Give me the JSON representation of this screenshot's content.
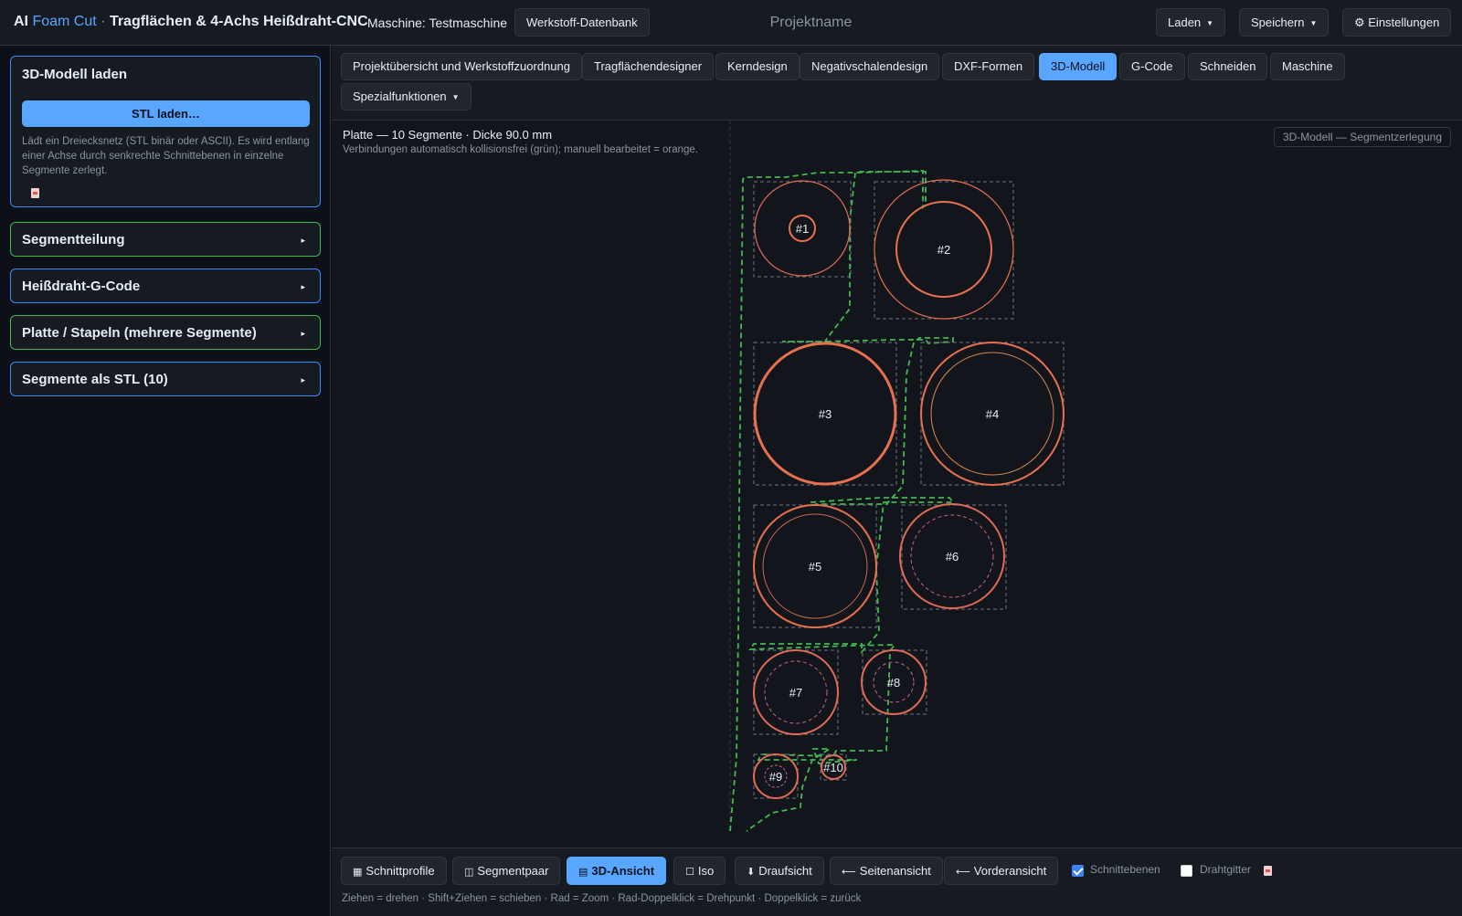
{
  "header": {
    "title_prefix": "AI",
    "title_accent": "Foam Cut",
    "title_sep": "·",
    "title_rest": "Tragflächen & 4-Achs Heißdraht-CNC",
    "machine": "Maschine: Testmaschine",
    "material_db_label": "Werkstoff-Datenbank",
    "project_placeholder": "Projektname",
    "load_label": "Laden",
    "save_label": "Speichern",
    "settings_label": "⚙ Einstellungen"
  },
  "sidebar": {
    "load_panel": {
      "title": "3D-Modell laden",
      "button": "STL laden…",
      "description": "Lädt ein Dreiecksnetz (STL binär oder ASCII). Es wird entlang einer Achse durch senkrechte Schnittebenen in einzelne Segmente zerlegt."
    },
    "panels": [
      {
        "title": "Segmentteilung"
      },
      {
        "title": "Heißdraht-G-Code"
      },
      {
        "title": "Platte / Stapeln (mehrere Segmente)"
      },
      {
        "title": "Segmente als STL (10)"
      }
    ],
    "arrow": "▸"
  },
  "tabs": [
    {
      "label": "Projektübersicht und Werkstoffzuordnung",
      "active": false
    },
    {
      "label": "Tragflächendesigner",
      "active": false
    },
    {
      "label": "Kerndesign",
      "active": false
    },
    {
      "label": "Negativschalendesign",
      "active": false
    },
    {
      "label": "DXF-Formen",
      "active": false
    },
    {
      "label": "3D-Modell",
      "active": true
    },
    {
      "label": "G-Code",
      "active": false
    },
    {
      "label": "Schneiden",
      "active": false
    },
    {
      "label": "Maschine",
      "active": false
    },
    {
      "label": "Spezialfunktionen",
      "active": false
    }
  ],
  "canvas": {
    "plate_info": "Platte — 10 Segmente · Dicke 90.0 mm",
    "plate_sub": "Verbindungen automatisch kollisionsfrei (grün); manuell bearbeitet = orange.",
    "view_badge": "3D-Modell — Segmentzerlegung",
    "segments": [
      "#1",
      "#2",
      "#3",
      "#4",
      "#5",
      "#6",
      "#7",
      "#8",
      "#9",
      "#10"
    ],
    "colors": {
      "contour": "#e8704f",
      "inner": "#e06a55",
      "path": "#3fb950",
      "box": "#6e7681"
    }
  },
  "bottombar": {
    "buttons": [
      {
        "icon": "▦",
        "label": "Schnittprofile",
        "active": false
      },
      {
        "icon": "◫",
        "label": "Segmentpaar",
        "active": false
      },
      {
        "icon": "▤",
        "label": "3D-Ansicht",
        "active": true
      },
      {
        "icon": "☐",
        "label": "Iso",
        "active": false
      },
      {
        "icon": "⬇",
        "label": "Draufsicht",
        "active": false
      },
      {
        "icon": "⟵",
        "label": "Seitenansicht",
        "active": false
      },
      {
        "icon": "⟵",
        "label": "Vorderansicht",
        "active": false
      }
    ],
    "checkboxes": [
      {
        "label": "Schnittebenen",
        "checked": true
      },
      {
        "label": "Drahtgitter",
        "checked": false
      }
    ],
    "hint": "Ziehen = drehen · Shift+Ziehen = schieben · Rad = Zoom · Rad-Doppelklick = Drehpunkt · Doppelklick = zurück"
  }
}
